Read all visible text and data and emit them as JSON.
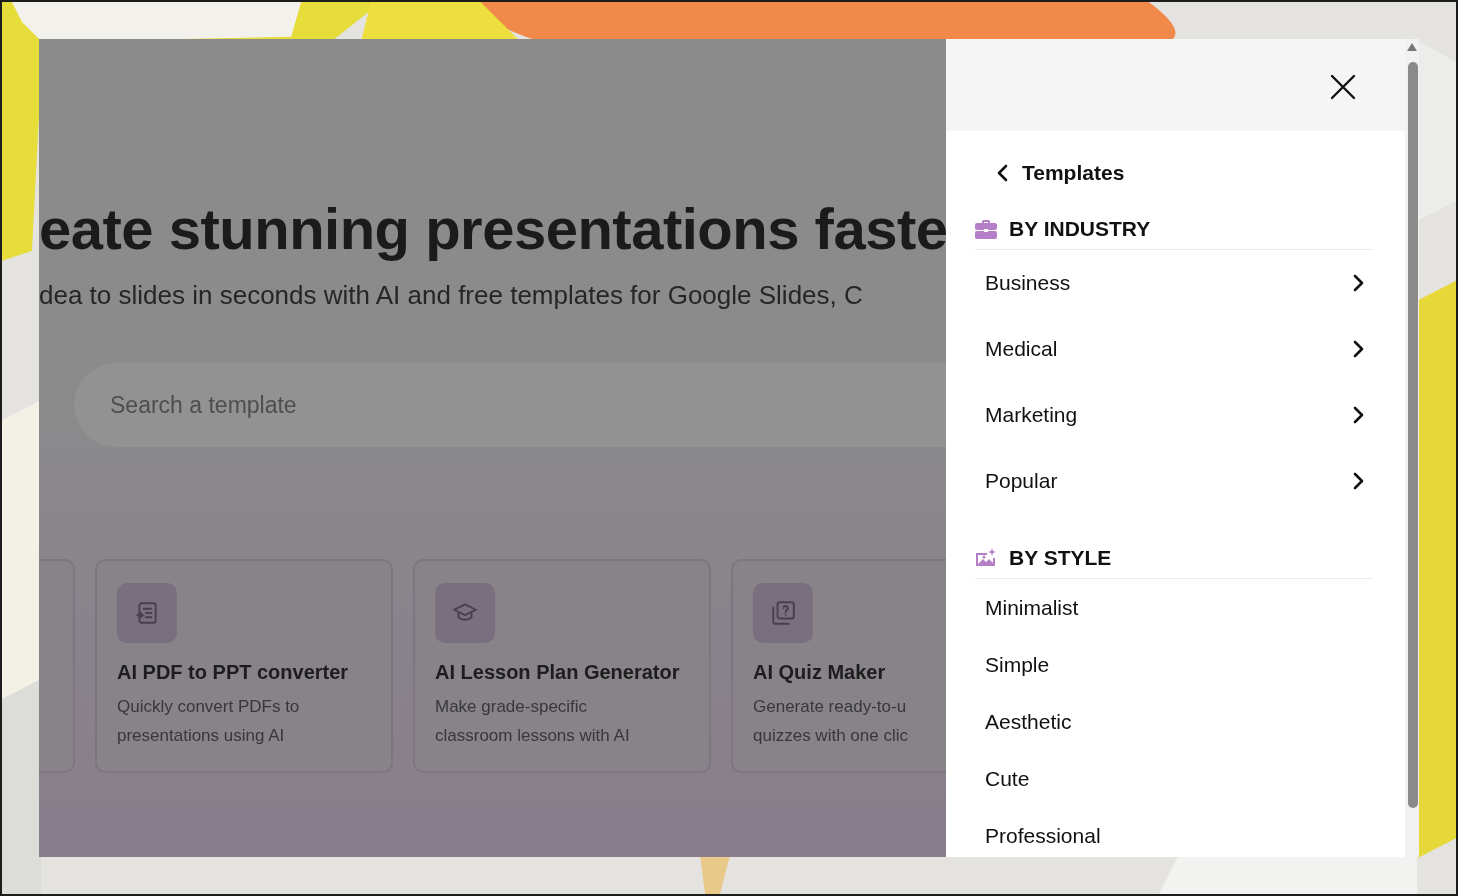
{
  "page": {
    "headline": "eate stunning presentations faste",
    "subtitle": "dea to slides in seconds with AI and free templates for Google Slides, C",
    "search": {
      "placeholder": "Search a template"
    },
    "cards": [
      {
        "kind": "partial"
      },
      {
        "kind": "converter",
        "title": "AI PDF to PPT converter",
        "description_lines": [
          "Quickly convert PDFs to",
          "presentations using AI"
        ]
      },
      {
        "kind": "lesson",
        "title": "AI Lesson Plan Generator",
        "description_lines": [
          "Make grade-specific",
          "classroom lessons with AI"
        ]
      },
      {
        "kind": "quiz",
        "title": "AI Quiz Maker",
        "description_lines": [
          "Generate ready-to-u",
          "quizzes with one clic"
        ]
      }
    ]
  },
  "drawer": {
    "back_label": "Templates",
    "sections": [
      {
        "kind": "industry",
        "title": "BY INDUSTRY",
        "items": [
          {
            "label": "Business",
            "expandable": true
          },
          {
            "label": "Medical",
            "expandable": true
          },
          {
            "label": "Marketing",
            "expandable": true
          },
          {
            "label": "Popular",
            "expandable": true
          }
        ]
      },
      {
        "kind": "style",
        "title": "BY STYLE",
        "items": [
          {
            "label": "Minimalist",
            "expandable": false
          },
          {
            "label": "Simple",
            "expandable": false
          },
          {
            "label": "Aesthetic",
            "expandable": false
          },
          {
            "label": "Cute",
            "expandable": false
          },
          {
            "label": "Professional",
            "expandable": false
          }
        ]
      }
    ]
  }
}
